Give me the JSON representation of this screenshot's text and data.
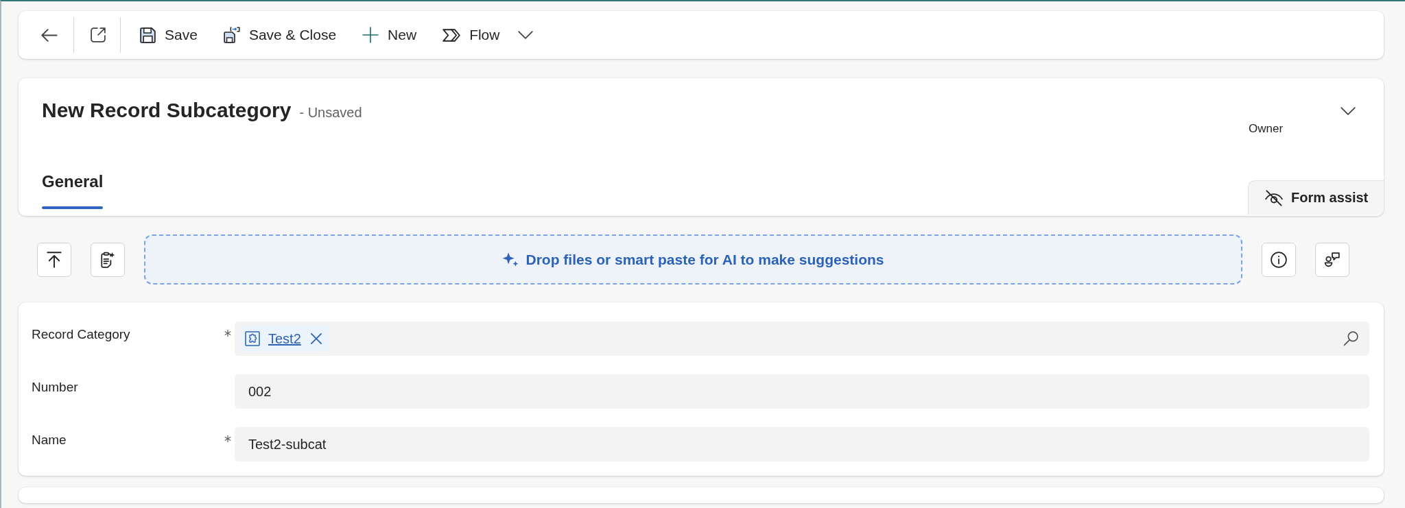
{
  "toolbar": {
    "buttons": [
      {
        "label": "Save",
        "has_menu": false
      },
      {
        "label": "Save & Close",
        "has_menu": false
      },
      {
        "label": "New",
        "has_menu": false
      },
      {
        "label": "Flow",
        "has_menu": true
      }
    ]
  },
  "header": {
    "title": "New Record Subcategory",
    "status": "- Unsaved",
    "expanded": false,
    "owner_label": "Owner"
  },
  "tabs": [
    {
      "label": "General",
      "selected": true
    }
  ],
  "form_assist": {
    "label": "Form assist"
  },
  "ai_bar": {
    "prompt": "Drop files or smart paste for AI to make suggestions"
  },
  "form": {
    "fields": [
      {
        "label": "Record Category",
        "required": true,
        "kind": "lookup",
        "value": "Test2"
      },
      {
        "label": "Number",
        "required": false,
        "kind": "text",
        "value": "002"
      },
      {
        "label": "Name",
        "required": true,
        "kind": "text",
        "value": "Test2-subcat"
      }
    ]
  }
}
